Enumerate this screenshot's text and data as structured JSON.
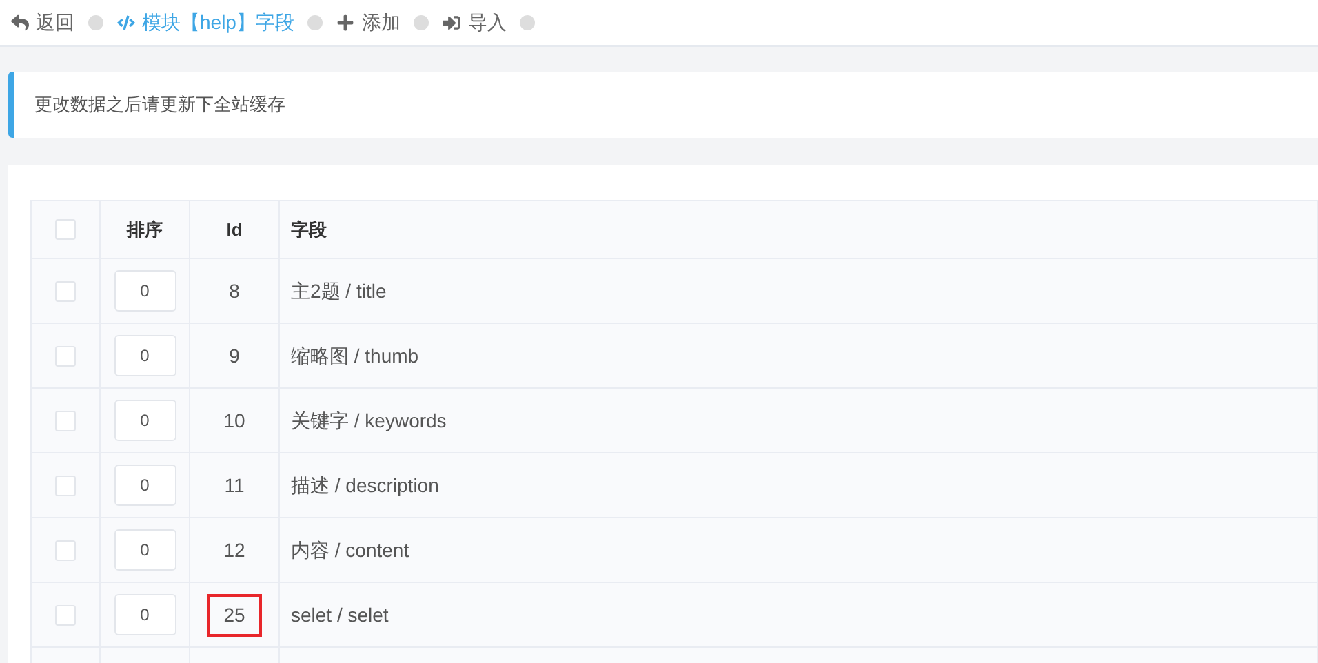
{
  "nav": [
    {
      "kind": "back",
      "label": "返回",
      "selected": false
    },
    {
      "kind": "code",
      "label": "模块【help】字段",
      "selected": true
    },
    {
      "kind": "add",
      "label": "添加",
      "selected": false
    },
    {
      "kind": "import",
      "label": "导入",
      "selected": false
    }
  ],
  "notice": "更改数据之后请更新下全站缓存",
  "table": {
    "all_checked": false,
    "columns": [
      "排序",
      "Id",
      "字段"
    ],
    "rows": [
      {
        "checked": false,
        "order": "0",
        "id": "8",
        "field": "主2题 / title",
        "highlighted": false
      },
      {
        "checked": false,
        "order": "0",
        "id": "9",
        "field": "缩略图 / thumb",
        "highlighted": false
      },
      {
        "checked": false,
        "order": "0",
        "id": "10",
        "field": "关键字 / keywords",
        "highlighted": false
      },
      {
        "checked": false,
        "order": "0",
        "id": "11",
        "field": "描述 / description",
        "highlighted": false
      },
      {
        "checked": false,
        "order": "0",
        "id": "12",
        "field": "内容 / content",
        "highlighted": false
      },
      {
        "checked": false,
        "order": "0",
        "id": "25",
        "field": "selet / selet",
        "highlighted": true
      }
    ]
  }
}
